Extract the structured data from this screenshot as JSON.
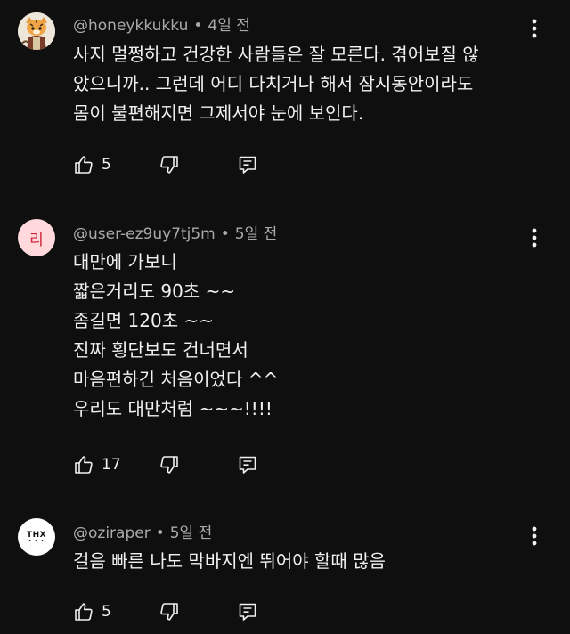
{
  "comments": [
    {
      "author": "@honeykkukku",
      "time": "4일 전",
      "avatar": {
        "kind": "illustration",
        "icon": "tiger-icon"
      },
      "lines": [
        "사지 멀쩡하고 건강한 사람들은 잘 모른다. 겪어보질 않",
        "았으니까.. 그런데 어디 다치거나 해서 잠시동안이라도",
        "몸이 불편해지면 그제서야 눈에 보인다."
      ],
      "likes": "5"
    },
    {
      "author": "@user-ez9uy7tj5m",
      "time": "5일 전",
      "avatar": {
        "kind": "letter",
        "letter": "리",
        "bg": "#ffd9dc",
        "fg": "#d2233a"
      },
      "lines": [
        "대만에 가보니",
        "짧은거리도 90초 ~~",
        "좀길면 120초 ~~",
        "진짜 횡단보도 건너면서",
        "마음편하긴 처음이었다 ^^",
        "우리도 대만처럼 ~~~!!!!"
      ],
      "likes": "17"
    },
    {
      "author": "@oziraper",
      "time": "5일 전",
      "avatar": {
        "kind": "logo",
        "text": "THX",
        "dots": "• • •"
      },
      "lines": [
        "걸음 빠른 나도 막바지엔 뛰어야 할때 많음"
      ],
      "likes": "5"
    }
  ],
  "separator": "•",
  "colors": {
    "background": "#0f0f0f",
    "text": "#f1f1f1",
    "meta": "#aaaaaa"
  },
  "icons": [
    "like-icon",
    "dislike-icon",
    "reply-icon",
    "more-options-icon"
  ]
}
